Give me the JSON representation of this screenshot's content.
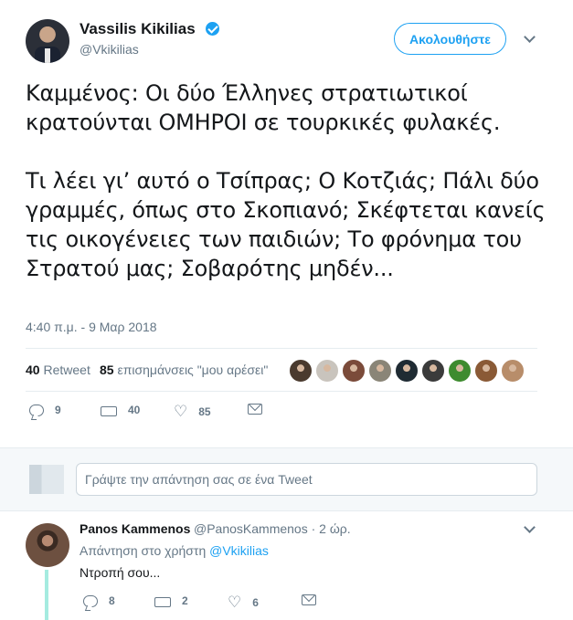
{
  "tweet": {
    "author_name": "Vassilis Kikilias",
    "author_handle": "@Vkikilias",
    "follow_label": "Ακολουθήστε",
    "text": "Καμμένος: Οι δύο Έλληνες στρατιωτικοί κρατούνται ΟΜΗΡΟΙ σε τουρκικές φυλακές.\n\nΤι λέει γι’ αυτό ο Τσίπρας; Ο Κοτζιάς; Πάλι δύο γραμμές, όπως στο Σκοπιανό; Σκέφτεται κανείς τις οικογένειες των παιδιών; Το φρόνημα του Στρατού μας; Σοβαρότης μηδέν...",
    "timestamp": "4:40 π.μ. - 9 Μαρ 2018",
    "retweets_count": "40",
    "retweets_label": "Retweet",
    "likes_count": "85",
    "likes_label": "επισημάνσεις \"μου αρέσει\"",
    "replies": "9",
    "retweets": "40",
    "likes": "85",
    "liker_colors": [
      "#4a3a2e",
      "#c9c4bd",
      "#7b4b3a",
      "#8a8577",
      "#1f2b33",
      "#3b3b3b",
      "#3e8b2f",
      "#8a5a36",
      "#b88d6a"
    ]
  },
  "composer": {
    "placeholder": "Γράψτε την απάντηση σας σε ένα Tweet"
  },
  "reply": {
    "author_name": "Panos Kammenos",
    "author_handle": "@PanosKammenos · 2 ώρ.",
    "replying_prefix": "Απάντηση στο χρήστη",
    "replying_handle": "@Vkikilias",
    "text": "Ντροπή σου...",
    "replies": "8",
    "retweets": "2",
    "likes": "6"
  },
  "colors": {
    "accent": "#1da1f2",
    "muted": "#657786",
    "thread": "#a5ebe0"
  }
}
